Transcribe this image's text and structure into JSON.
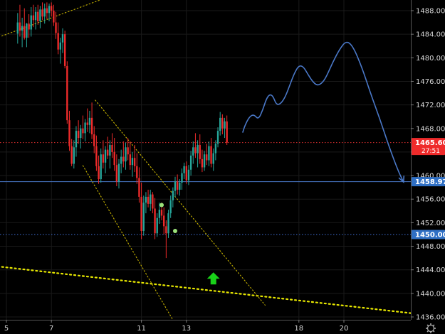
{
  "chart_data": {
    "type": "candlestick",
    "y_axis": {
      "range": [
        1435.5,
        1489.5
      ],
      "ticks": [
        "1488.00",
        "1484.00",
        "1480.00",
        "1476.00",
        "1472.00",
        "1468.00",
        "1464.00",
        "1460.00",
        "1456.00",
        "1452.00",
        "1448.00",
        "1444.00",
        "1440.00",
        "1436.00"
      ],
      "tick_values": [
        1488,
        1484,
        1480,
        1476,
        1472,
        1468,
        1464,
        1460,
        1456,
        1452,
        1448,
        1444,
        1440,
        1436
      ]
    },
    "x_axis": {
      "range": [
        4.8,
        24.2
      ],
      "ticks": [
        "5",
        "7",
        "11",
        "13",
        "18",
        "20"
      ],
      "tick_values": [
        5,
        7,
        11,
        13,
        18,
        20
      ]
    },
    "colors": {
      "up": "#26a69a",
      "up_bright": "#1ec51e",
      "down": "#ef2b2b",
      "background": "#000000",
      "projection": "#4a78c8"
    },
    "candles": [
      [
        5.5,
        1484.1,
        1487.6,
        1482.4,
        1486.0
      ],
      [
        5.6,
        1486.0,
        1489.0,
        1483.6,
        1484.6
      ],
      [
        5.7,
        1484.6,
        1486.8,
        1481.8,
        1485.4
      ],
      [
        5.8,
        1485.4,
        1488.4,
        1483.1,
        1483.4
      ],
      [
        5.9,
        1483.4,
        1485.9,
        1481.8,
        1485.8
      ],
      [
        6.0,
        1485.8,
        1487.4,
        1483.4,
        1484.8
      ],
      [
        6.1,
        1484.8,
        1488.6,
        1483.6,
        1487.2
      ],
      [
        6.2,
        1487.2,
        1489.0,
        1485.2,
        1486.4
      ],
      [
        6.3,
        1486.4,
        1488.6,
        1484.8,
        1487.8
      ],
      [
        6.4,
        1487.8,
        1489.0,
        1485.6,
        1486.2
      ],
      [
        6.5,
        1486.2,
        1488.8,
        1485.0,
        1488.2
      ],
      [
        6.6,
        1488.2,
        1489.4,
        1486.4,
        1487.0
      ],
      [
        6.7,
        1487.0,
        1489.2,
        1485.8,
        1488.4
      ],
      [
        6.8,
        1488.4,
        1489.4,
        1486.6,
        1487.6
      ],
      [
        6.9,
        1487.6,
        1489.2,
        1486.2,
        1488.8
      ],
      [
        7.0,
        1488.8,
        1489.4,
        1487.0,
        1488.0
      ],
      [
        7.1,
        1488.0,
        1489.0,
        1485.4,
        1486.0
      ],
      [
        7.2,
        1486.0,
        1487.8,
        1483.2,
        1484.2
      ],
      [
        7.3,
        1484.2,
        1486.0,
        1480.6,
        1481.4
      ],
      [
        7.4,
        1481.4,
        1483.4,
        1479.0,
        1482.6
      ],
      [
        7.5,
        1482.6,
        1485.0,
        1480.8,
        1484.0
      ],
      [
        7.6,
        1484.0,
        1484.6,
        1478.2,
        1478.6
      ],
      [
        7.7,
        1478.6,
        1479.4,
        1468.8,
        1469.4
      ],
      [
        7.8,
        1469.4,
        1471.0,
        1464.2,
        1465.0
      ],
      [
        7.9,
        1465.0,
        1466.2,
        1461.6,
        1462.0
      ],
      [
        8.0,
        1462.0,
        1466.0,
        1461.2,
        1464.8
      ],
      [
        8.1,
        1464.8,
        1468.4,
        1463.2,
        1467.6
      ],
      [
        8.2,
        1467.6,
        1469.4,
        1465.4,
        1466.4
      ],
      [
        8.3,
        1466.4,
        1468.6,
        1464.6,
        1468.0
      ],
      [
        8.4,
        1468.0,
        1470.2,
        1466.2,
        1467.2
      ],
      [
        8.5,
        1467.2,
        1469.6,
        1465.8,
        1469.0
      ],
      [
        8.6,
        1469.0,
        1471.4,
        1467.4,
        1468.6
      ],
      [
        8.7,
        1468.6,
        1471.0,
        1467.2,
        1469.8
      ],
      [
        8.8,
        1469.8,
        1472.4,
        1466.2,
        1467.0
      ],
      [
        8.9,
        1467.0,
        1468.4,
        1463.8,
        1465.0
      ],
      [
        9.0,
        1465.0,
        1466.8,
        1460.8,
        1461.6
      ],
      [
        9.1,
        1461.6,
        1463.4,
        1458.6,
        1459.4
      ],
      [
        9.2,
        1459.4,
        1464.6,
        1458.8,
        1463.6
      ],
      [
        9.3,
        1463.6,
        1466.0,
        1461.2,
        1462.2
      ],
      [
        9.4,
        1462.2,
        1465.0,
        1460.4,
        1464.4
      ],
      [
        9.5,
        1464.4,
        1466.6,
        1462.8,
        1463.4
      ],
      [
        9.6,
        1463.4,
        1466.0,
        1461.2,
        1465.2
      ],
      [
        9.7,
        1465.2,
        1467.2,
        1463.0,
        1464.0
      ],
      [
        9.8,
        1464.0,
        1466.4,
        1460.8,
        1461.8
      ],
      [
        9.9,
        1461.8,
        1463.6,
        1458.2,
        1459.0
      ],
      [
        10.0,
        1459.0,
        1462.8,
        1457.8,
        1462.0
      ],
      [
        10.1,
        1462.0,
        1464.4,
        1460.4,
        1463.2
      ],
      [
        10.2,
        1463.2,
        1465.8,
        1461.4,
        1462.4
      ],
      [
        10.3,
        1462.4,
        1465.6,
        1461.0,
        1464.8
      ],
      [
        10.4,
        1464.8,
        1466.4,
        1462.6,
        1463.6
      ],
      [
        10.5,
        1463.6,
        1465.8,
        1461.0,
        1461.8
      ],
      [
        10.6,
        1461.8,
        1464.0,
        1459.8,
        1463.0
      ],
      [
        10.7,
        1463.0,
        1465.2,
        1460.6,
        1461.6
      ],
      [
        10.8,
        1461.6,
        1463.8,
        1458.6,
        1459.6
      ],
      [
        10.9,
        1459.6,
        1461.4,
        1455.4,
        1456.4
      ],
      [
        11.0,
        1456.4,
        1458.8,
        1449.2,
        1450.6
      ],
      [
        11.1,
        1450.6,
        1456.6,
        1449.8,
        1455.4
      ],
      [
        11.2,
        1455.4,
        1457.2,
        1453.6,
        1456.4
      ],
      [
        11.3,
        1456.4,
        1457.6,
        1454.6,
        1455.2
      ],
      [
        11.4,
        1455.2,
        1457.6,
        1454.0,
        1456.8
      ],
      [
        11.5,
        1456.8,
        1457.2,
        1453.6,
        1454.4
      ],
      [
        11.6,
        1454.4,
        1456.2,
        1449.2,
        1450.2
      ],
      [
        11.7,
        1450.2,
        1453.6,
        1449.6,
        1452.8
      ],
      [
        11.8,
        1452.8,
        1455.4,
        1451.8,
        1454.2
      ],
      [
        11.9,
        1454.2,
        1455.4,
        1452.4,
        1453.2
      ],
      [
        12.0,
        1453.2,
        1454.6,
        1450.0,
        1451.4
      ],
      [
        12.1,
        1451.4,
        1452.4,
        1446.0,
        1450.2
      ],
      [
        12.2,
        1450.2,
        1454.2,
        1449.4,
        1453.6
      ],
      [
        12.3,
        1453.6,
        1456.6,
        1452.8,
        1455.8
      ],
      [
        12.4,
        1455.8,
        1458.0,
        1454.6,
        1457.4
      ],
      [
        12.5,
        1457.4,
        1459.8,
        1456.4,
        1459.0
      ],
      [
        12.6,
        1459.0,
        1460.2,
        1456.8,
        1457.6
      ],
      [
        12.7,
        1457.6,
        1459.4,
        1456.6,
        1458.8
      ],
      [
        12.8,
        1458.8,
        1461.2,
        1457.6,
        1460.4
      ],
      [
        12.9,
        1460.4,
        1462.2,
        1459.4,
        1461.6
      ],
      [
        13.0,
        1461.6,
        1462.4,
        1458.6,
        1459.2
      ],
      [
        13.1,
        1459.2,
        1461.8,
        1458.4,
        1461.0
      ],
      [
        13.2,
        1461.0,
        1464.2,
        1460.0,
        1463.4
      ],
      [
        13.3,
        1463.4,
        1465.8,
        1462.0,
        1464.8
      ],
      [
        13.4,
        1464.8,
        1467.2,
        1463.0,
        1463.8
      ],
      [
        13.5,
        1463.8,
        1466.0,
        1461.4,
        1465.2
      ],
      [
        13.6,
        1465.2,
        1467.0,
        1462.0,
        1462.8
      ],
      [
        13.7,
        1462.8,
        1464.4,
        1460.6,
        1461.4
      ],
      [
        13.8,
        1461.4,
        1464.2,
        1460.8,
        1463.6
      ],
      [
        13.9,
        1463.6,
        1465.4,
        1461.8,
        1462.6
      ],
      [
        14.0,
        1462.6,
        1465.8,
        1461.6,
        1465.0
      ],
      [
        14.1,
        1465.0,
        1466.4,
        1461.4,
        1462.0
      ],
      [
        14.2,
        1462.0,
        1464.6,
        1460.8,
        1463.8
      ],
      [
        14.3,
        1463.8,
        1466.0,
        1462.6,
        1465.4
      ],
      [
        14.4,
        1465.4,
        1468.2,
        1464.8,
        1467.6
      ],
      [
        14.5,
        1467.6,
        1470.8,
        1466.8,
        1469.8
      ],
      [
        14.6,
        1469.8,
        1470.4,
        1467.0,
        1468.0
      ],
      [
        14.7,
        1468.0,
        1469.8,
        1466.4,
        1469.2
      ],
      [
        14.8,
        1469.2,
        1470.2,
        1465.2,
        1465.6
      ]
    ],
    "markers": [
      {
        "x": 11.9,
        "y": 1455.0
      },
      {
        "x": 12.5,
        "y": 1450.6
      }
    ],
    "arrow": {
      "x": 14.2,
      "y": 1442.6
    },
    "price_lines": [
      {
        "value": 1465.6,
        "label": "1465.60",
        "timer": "27:51",
        "line_color": "#e03131",
        "tag_color": "#ef2b2b",
        "style": "dotted"
      },
      {
        "value": 1458.97,
        "label": "1458.97",
        "line_color": "#4a78c8",
        "tag_color": "#2f6fc4",
        "style": "solid"
      },
      {
        "value": 1450.0,
        "label": "1450.00",
        "line_color": "#3f6fd6",
        "tag_color": "#2f6fc4",
        "style": "dotted"
      }
    ],
    "trendlines": [
      {
        "from": [
          4.8,
          1483.7
        ],
        "to": [
          9.3,
          1490.0
        ],
        "color": "#c8b400",
        "style": "dotted"
      },
      {
        "from": [
          4.8,
          1444.5
        ],
        "to": [
          24.0,
          1436.2
        ],
        "color": "#e8e800",
        "style": "bigdot"
      },
      {
        "from": [
          8.95,
          1472.8
        ],
        "to": [
          16.5,
          1438.0
        ],
        "color": "#c8b400",
        "style": "dotted"
      },
      {
        "from": [
          8.4,
          1461.7
        ],
        "to": [
          12.4,
          1435.5
        ],
        "color": "#c8b400",
        "style": "dotted"
      }
    ],
    "projection": [
      [
        15.5,
        1467.3
      ],
      [
        15.6,
        1468.5
      ],
      [
        15.8,
        1470.0
      ],
      [
        16.0,
        1470.4
      ],
      [
        16.2,
        1469.5
      ],
      [
        16.4,
        1471.2
      ],
      [
        16.55,
        1473.0
      ],
      [
        16.7,
        1473.8
      ],
      [
        16.85,
        1473.5
      ],
      [
        17.0,
        1472.0
      ],
      [
        17.2,
        1472.2
      ],
      [
        17.4,
        1473.4
      ],
      [
        17.6,
        1475.4
      ],
      [
        17.8,
        1477.4
      ],
      [
        18.0,
        1478.7
      ],
      [
        18.2,
        1478.5
      ],
      [
        18.4,
        1477.2
      ],
      [
        18.6,
        1476.0
      ],
      [
        18.8,
        1475.3
      ],
      [
        19.0,
        1475.6
      ],
      [
        19.2,
        1476.6
      ],
      [
        19.5,
        1479.2
      ],
      [
        19.8,
        1481.4
      ],
      [
        20.1,
        1482.9
      ],
      [
        20.4,
        1482.0
      ],
      [
        20.8,
        1478.4
      ],
      [
        21.2,
        1473.8
      ],
      [
        21.6,
        1469.6
      ],
      [
        22.0,
        1465.0
      ],
      [
        22.4,
        1460.9
      ],
      [
        22.65,
        1458.9
      ]
    ]
  }
}
